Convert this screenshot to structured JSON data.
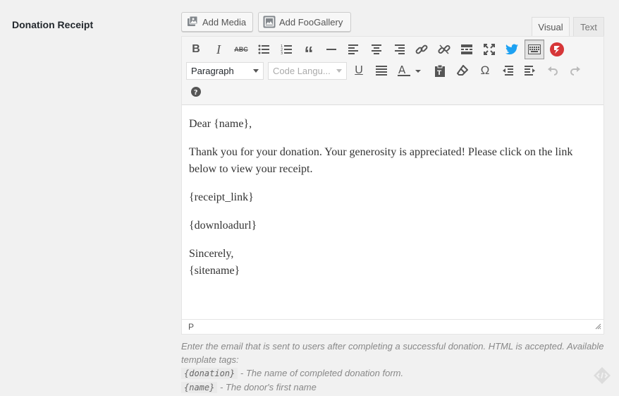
{
  "field": {
    "label": "Donation Receipt"
  },
  "media_buttons": [
    {
      "label": "Add Media",
      "icon": "add-media-icon"
    },
    {
      "label": "Add FooGallery",
      "icon": "gallery-icon"
    }
  ],
  "tabs": {
    "visual": "Visual",
    "text": "Text"
  },
  "toolbar": {
    "format_select": "Paragraph",
    "code_language_select": "Code Langu...",
    "row1_icons": [
      "bold-icon",
      "italic-icon",
      "strikethrough-icon",
      "bullet-list-icon",
      "numbered-list-icon",
      "blockquote-icon",
      "horizontal-rule-icon",
      "align-left-icon",
      "align-center-icon",
      "align-right-icon",
      "link-icon",
      "unlink-icon",
      "read-more-icon",
      "fullscreen-icon",
      "twitter-icon",
      "toolbar-toggle-icon",
      "plugin-icon"
    ],
    "row2_icons": [
      "underline-icon",
      "justify-icon",
      "text-color-icon",
      "paste-text-icon",
      "clear-formatting-icon",
      "special-character-icon",
      "outdent-icon",
      "indent-icon",
      "undo-icon",
      "redo-icon"
    ],
    "help_icon": "help-icon"
  },
  "content": {
    "paragraphs": [
      "Dear {name},",
      "Thank you for your donation. Your generosity is appreciated! Please click on the link below to view your receipt.",
      "{receipt_link}",
      "{downloadurl}"
    ],
    "closing_line1": "Sincerely,",
    "closing_line2": "{sitename}"
  },
  "statusbar": {
    "path": "P"
  },
  "description": {
    "text": "Enter the email that is sent to users after completing a successful donation. HTML is accepted. Available template tags:",
    "tags": [
      {
        "tag": "{donation}",
        "desc": "- The name of completed donation form."
      },
      {
        "tag": "{name}",
        "desc": "- The donor's first name"
      }
    ]
  },
  "colors": {
    "twitter": "#1da1f2",
    "plugin_red": "#d63638",
    "accent": "#0073aa"
  }
}
